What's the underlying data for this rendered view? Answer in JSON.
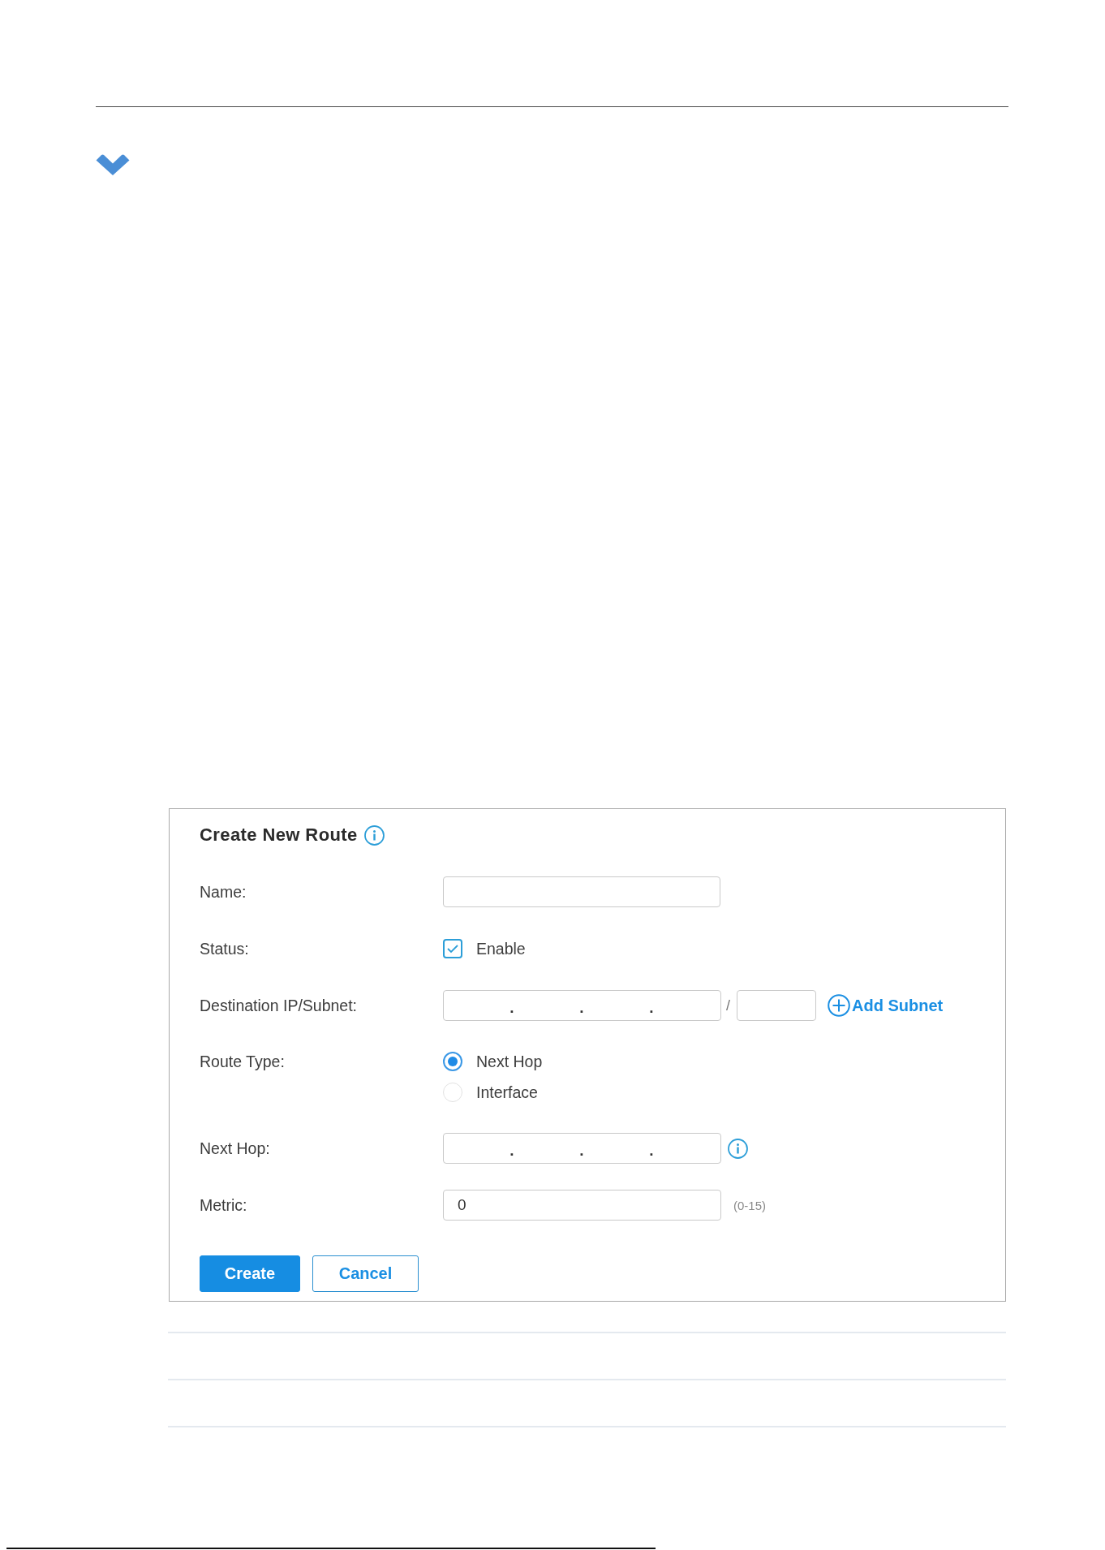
{
  "form": {
    "title": "Create New Route",
    "fields": [
      {
        "kind": "text",
        "label": "Name:"
      },
      {
        "kind": "checkbox",
        "label": "Status:",
        "option": "Enable",
        "checked": true
      },
      {
        "kind": "ip_subnet",
        "label": "Destination IP/Subnet:",
        "separators": [
          ".",
          ".",
          "."
        ],
        "slash": "/",
        "link": "Add Subnet"
      },
      {
        "kind": "radio",
        "label": "Route Type:",
        "options": [
          {
            "label": "Next Hop",
            "selected": true
          },
          {
            "label": "Interface",
            "selected": false
          }
        ]
      },
      {
        "kind": "ip",
        "label": "Next Hop:",
        "separators": [
          ".",
          ".",
          "."
        ],
        "info": true
      },
      {
        "kind": "number",
        "label": "Metric:",
        "value": "0",
        "hint": "(0-15)"
      }
    ],
    "buttons": [
      {
        "label": "Create",
        "kind": "primary"
      },
      {
        "label": "Cancel",
        "kind": "secondary"
      }
    ]
  }
}
